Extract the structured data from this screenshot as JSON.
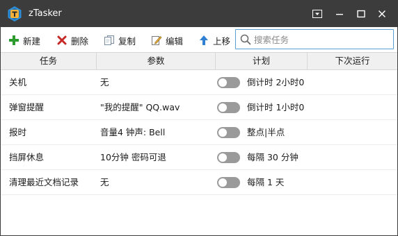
{
  "window": {
    "title": "zTasker"
  },
  "toolbar": {
    "new_label": "新建",
    "delete_label": "删除",
    "copy_label": "复制",
    "edit_label": "编辑",
    "moveup_label": "上移"
  },
  "search": {
    "placeholder": "搜索任务",
    "value": ""
  },
  "columns": [
    "任务",
    "参数",
    "计划",
    "下次运行"
  ],
  "tasks": [
    {
      "name": "关机",
      "params": "无",
      "enabled": false,
      "schedule": "倒计时 2小时0",
      "next_run": ""
    },
    {
      "name": "弹窗提醒",
      "params": "\"我的提醒\" QQ.wav",
      "enabled": false,
      "schedule": "倒计时 1小时0",
      "next_run": ""
    },
    {
      "name": "报时",
      "params": "音量4 钟声: Bell",
      "enabled": false,
      "schedule": "整点|半点",
      "next_run": ""
    },
    {
      "name": "挡屏休息",
      "params": "10分钟 密码可退",
      "enabled": false,
      "schedule": "每隔 30 分钟",
      "next_run": ""
    },
    {
      "name": "清理最近文档记录",
      "params": "无",
      "enabled": false,
      "schedule": "每隔 1 天",
      "next_run": ""
    }
  ],
  "colors": {
    "titlebar": "#3c3c3c",
    "toggle_off": "#9a9a9a",
    "search_border": "#5aa0d8",
    "add_icon": "#2e9b2e",
    "delete_icon": "#c62828",
    "moveup_icon": "#2f7fd3"
  }
}
